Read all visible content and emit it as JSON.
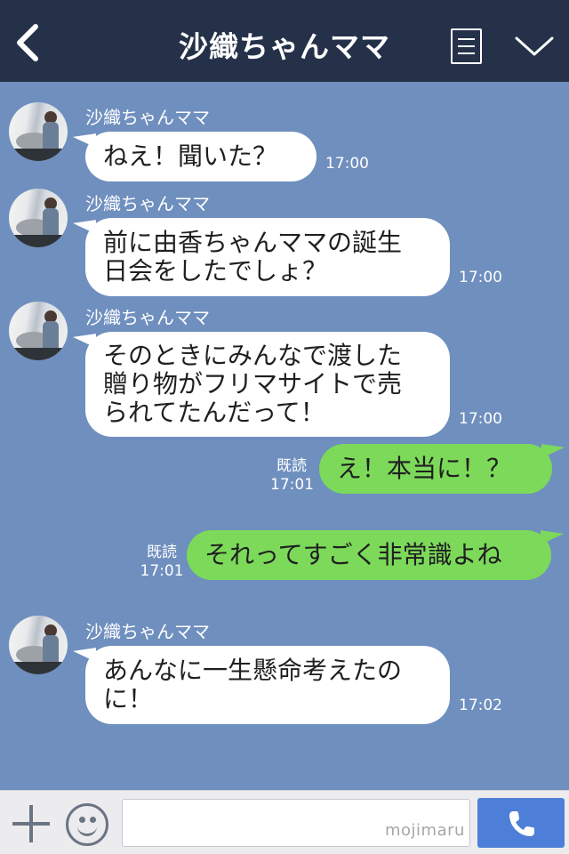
{
  "header": {
    "title": "沙織ちゃんママ",
    "back_icon": "chevron-left-icon",
    "menu_icon": "notes-icon",
    "dropdown_icon": "chevron-down-icon"
  },
  "messages": [
    {
      "sender": "沙織ちゃんママ",
      "lines": [
        "ねえ！聞いた？"
      ],
      "time": "17:00"
    },
    {
      "sender": "沙織ちゃんママ",
      "lines": [
        "前に由香ちゃんママの誕生",
        "日会をしたでしょ？"
      ],
      "time": "17:00"
    },
    {
      "sender": "沙織ちゃんママ",
      "lines": [
        "そのときにみんなで渡した",
        "贈り物がフリマサイトで売",
        "られてたんだって！"
      ],
      "time": "17:00"
    },
    {
      "lines": [
        "え！本当に！？"
      ],
      "read": "既読",
      "time": "17:01"
    },
    {
      "lines": [
        "それってすごく非常識よね"
      ],
      "read": "既読",
      "time": "17:01"
    },
    {
      "sender": "沙織ちゃんママ",
      "lines": [
        "あんなに一生懸命考えたの",
        "に！"
      ],
      "time": "17:02"
    }
  ],
  "footer": {
    "plus_icon": "plus-icon",
    "emoji_icon": "smiley-icon",
    "input_value": "",
    "watermark": "mojimaru",
    "send_icon": "phone-icon"
  },
  "colors": {
    "header_bg": "#243149",
    "chat_bg": "#6f8fbe",
    "incoming_bubble": "#ffffff",
    "outgoing_bubble": "#7cd95a",
    "send_button": "#4e7fd8"
  }
}
